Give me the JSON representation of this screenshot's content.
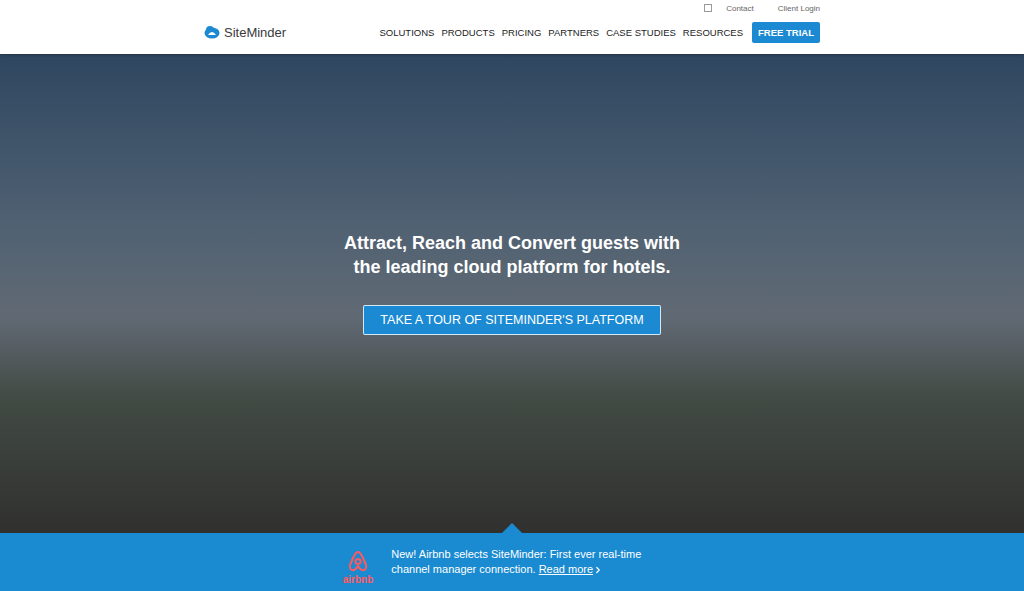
{
  "utility_bar": {
    "links": [
      "Contact",
      "Client Login"
    ]
  },
  "logo": {
    "text": "SiteMinder"
  },
  "nav": {
    "items": [
      "SOLUTIONS",
      "PRODUCTS",
      "PRICING",
      "PARTNERS",
      "CASE STUDIES",
      "RESOURCES"
    ],
    "cta": "FREE TRIAL"
  },
  "hero": {
    "headline_lines": [
      "Attract, Reach and Convert guests with",
      "the leading cloud platform for hotels."
    ],
    "button": "TAKE A TOUR OF SITEMINDER'S PLATFORM"
  },
  "banner": {
    "brand": "airbnb",
    "text": "New! Airbnb selects SiteMinder: First ever real-time channel manager connection.",
    "link": "Read more"
  }
}
